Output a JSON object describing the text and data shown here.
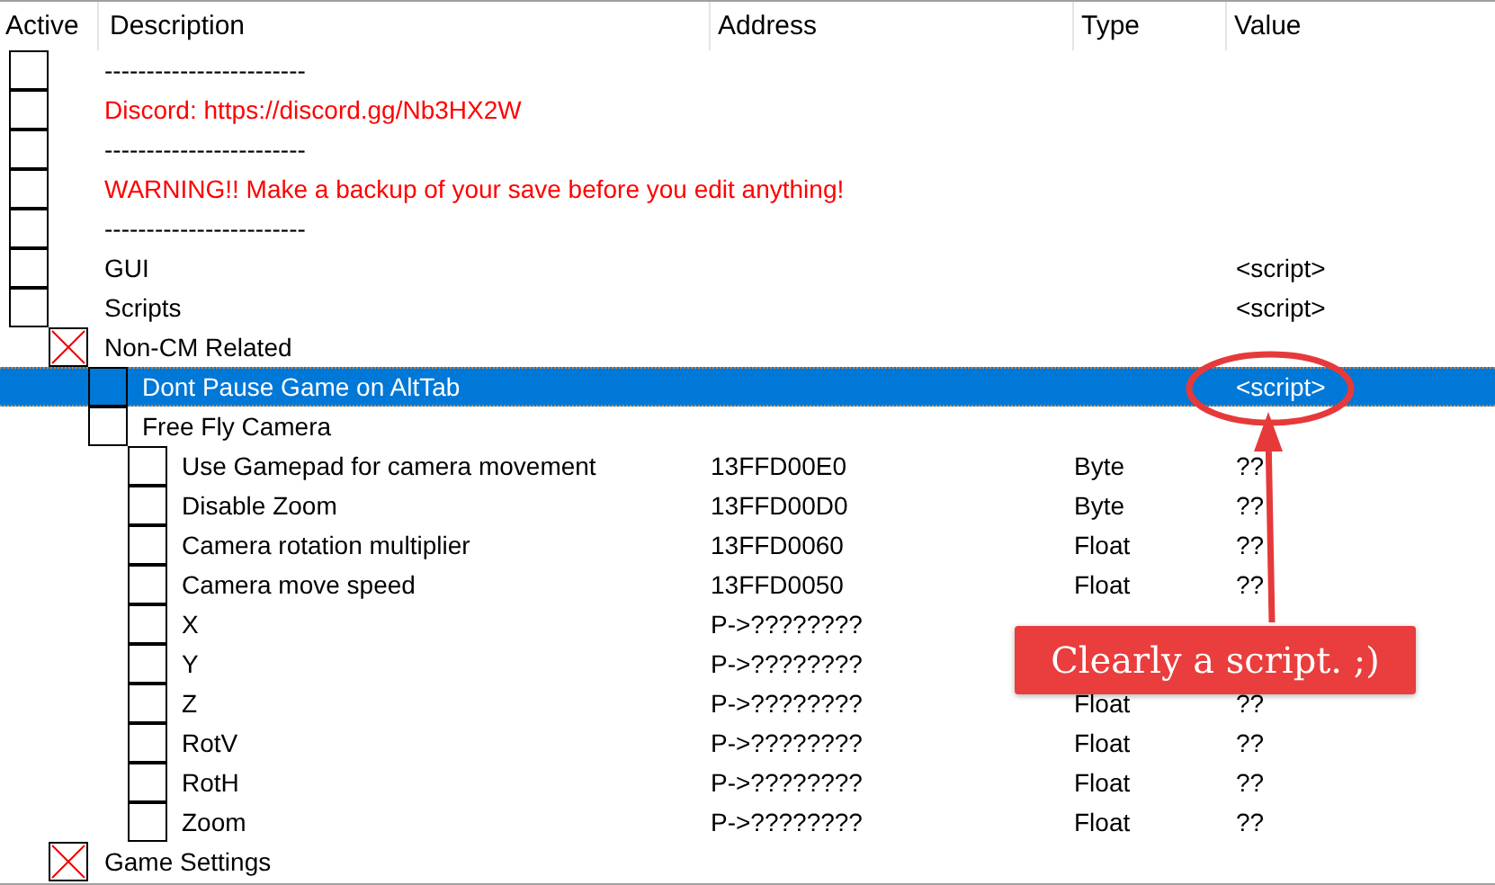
{
  "table": {
    "columns": [
      "Active",
      "Description",
      "Address",
      "Type",
      "Value"
    ],
    "rows": [
      {
        "kind": "entry",
        "checked": false,
        "description": "------------------------",
        "selected": false
      },
      {
        "kind": "entry",
        "checked": false,
        "description": "Discord: https://discord.gg/Nb3HX2W",
        "color": "#ff0000",
        "selected": false
      },
      {
        "kind": "entry",
        "checked": false,
        "description": "------------------------",
        "selected": false
      },
      {
        "kind": "entry",
        "checked": false,
        "description": "WARNING!! Make a backup of your save before you edit anything!",
        "color": "#ff0000",
        "selected": false
      },
      {
        "kind": "entry",
        "checked": false,
        "description": "------------------------",
        "selected": false
      },
      {
        "kind": "entry",
        "checked": false,
        "description": "GUI",
        "value": "<script>",
        "selected": false
      },
      {
        "kind": "entry",
        "checked": false,
        "description": "Scripts",
        "value": "<script>",
        "selected": false,
        "children": [
          {
            "kind": "group",
            "description": "Non-CM Related",
            "selected": false,
            "children": [
              {
                "kind": "entry",
                "checked": false,
                "description": "Dont Pause Game on AltTab",
                "value": "<script>",
                "selected": true
              },
              {
                "kind": "entry",
                "checked": false,
                "description": "Free Fly Camera",
                "selected": false,
                "children": [
                  {
                    "kind": "entry",
                    "checked": false,
                    "description": "Use Gamepad for camera movement",
                    "address": "13FFD00E0",
                    "type": "Byte",
                    "value": "??",
                    "selected": false
                  },
                  {
                    "kind": "entry",
                    "checked": false,
                    "description": "Disable Zoom",
                    "address": "13FFD00D0",
                    "type": "Byte",
                    "value": "??",
                    "selected": false
                  },
                  {
                    "kind": "entry",
                    "checked": false,
                    "description": "Camera rotation multiplier",
                    "address": "13FFD0060",
                    "type": "Float",
                    "value": "??",
                    "selected": false
                  },
                  {
                    "kind": "entry",
                    "checked": false,
                    "description": "Camera move speed",
                    "address": "13FFD0050",
                    "type": "Float",
                    "value": "??",
                    "selected": false
                  },
                  {
                    "kind": "entry",
                    "checked": false,
                    "description": "X",
                    "address": "P->????????",
                    "selected": false
                  },
                  {
                    "kind": "entry",
                    "checked": false,
                    "description": "Y",
                    "address": "P->????????",
                    "selected": false
                  },
                  {
                    "kind": "entry",
                    "checked": false,
                    "description": "Z",
                    "address": "P->????????",
                    "type": "Float",
                    "value": "??",
                    "selected": false
                  },
                  {
                    "kind": "entry",
                    "checked": false,
                    "description": "RotV",
                    "address": "P->????????",
                    "type": "Float",
                    "value": "??",
                    "selected": false
                  },
                  {
                    "kind": "entry",
                    "checked": false,
                    "description": "RotH",
                    "address": "P->????????",
                    "type": "Float",
                    "value": "??",
                    "selected": false
                  },
                  {
                    "kind": "entry",
                    "checked": false,
                    "description": "Zoom",
                    "address": "P->????????",
                    "type": "Float",
                    "value": "??",
                    "selected": false
                  }
                ]
              }
            ]
          },
          {
            "kind": "group",
            "description": "Game Settings",
            "selected": false
          }
        ]
      }
    ]
  },
  "annotation": {
    "callout": "Clearly a script. ;)"
  }
}
